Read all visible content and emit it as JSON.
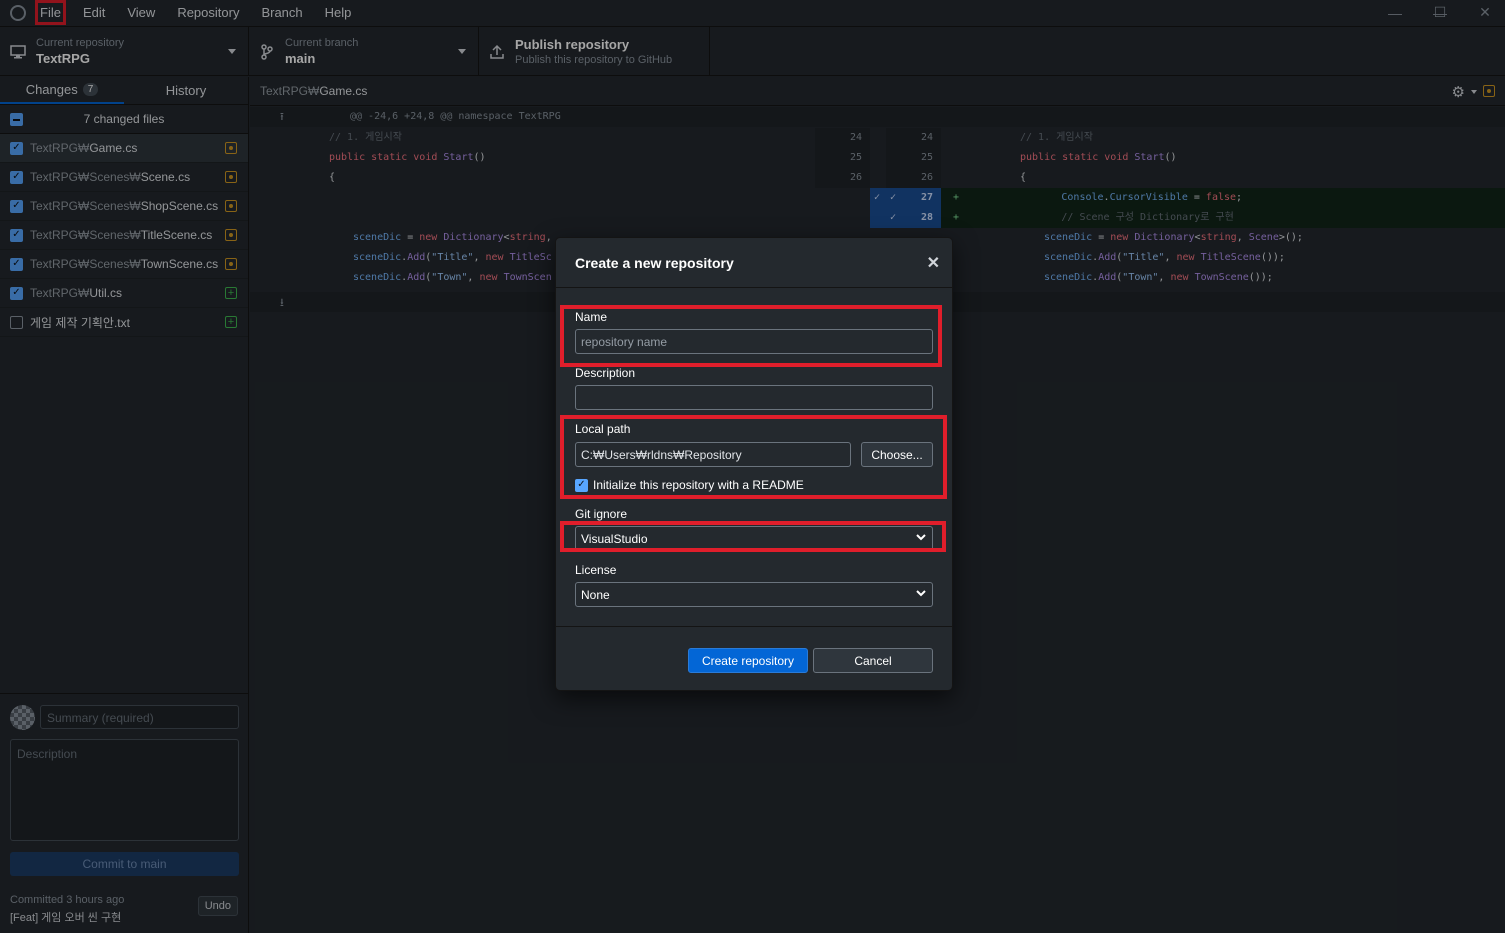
{
  "menu": {
    "items": [
      "File",
      "Edit",
      "View",
      "Repository",
      "Branch",
      "Help"
    ]
  },
  "window_controls": {
    "minimize": "—",
    "maximize": "☐",
    "close": "✕"
  },
  "toolbar": {
    "repo_label": "Current repository",
    "repo_value": "TextRPG",
    "branch_label": "Current branch",
    "branch_value": "main",
    "publish_title": "Publish repository",
    "publish_sub": "Publish this repository to GitHub"
  },
  "sidebar": {
    "tab_changes": "Changes",
    "tab_changes_count": "7",
    "tab_history": "History",
    "changed_files_label": "7 changed files",
    "files": [
      {
        "dir": "TextRPG₩",
        "name": "Game.cs",
        "checked": true,
        "status": "modified",
        "selected": true
      },
      {
        "dir": "TextRPG₩Scenes₩",
        "name": "Scene.cs",
        "checked": true,
        "status": "modified"
      },
      {
        "dir": "TextRPG₩Scenes₩",
        "name": "ShopScene.cs",
        "checked": true,
        "status": "modified"
      },
      {
        "dir": "TextRPG₩Scenes₩",
        "name": "TitleScene.cs",
        "checked": true,
        "status": "modified"
      },
      {
        "dir": "TextRPG₩Scenes₩",
        "name": "TownScene.cs",
        "checked": true,
        "status": "modified"
      },
      {
        "dir": "TextRPG₩",
        "name": "Util.cs",
        "checked": true,
        "status": "added"
      },
      {
        "dir": "",
        "name": "게임 제작 기획안.txt",
        "checked": false,
        "status": "added"
      }
    ],
    "summary_placeholder": "Summary (required)",
    "description_placeholder": "Description",
    "commit_button": "Commit to main",
    "committed_time": "Committed 3 hours ago",
    "committed_msg": "[Feat] 게임 오버 씬 구현",
    "undo_button": "Undo"
  },
  "diff": {
    "file_dir": "TextRPG₩",
    "file_name": "Game.cs",
    "hunk_header": "@@ -24,6 +24,8 @@ namespace TextRPG",
    "old_numbers": [
      "24",
      "25",
      "26"
    ],
    "new_numbers": [
      "24",
      "25",
      "26",
      "27",
      "28"
    ],
    "plus_sign": "+"
  },
  "modal": {
    "title": "Create a new repository",
    "close_icon": "✕",
    "name_label": "Name",
    "name_placeholder": "repository name",
    "description_label": "Description",
    "local_path_label": "Local path",
    "local_path_value": "C:₩Users₩rldns₩Repository",
    "choose_button": "Choose...",
    "readme_label": "Initialize this repository with a README",
    "readme_checked": true,
    "gitignore_label": "Git ignore",
    "gitignore_value": "VisualStudio",
    "license_label": "License",
    "license_value": "None",
    "create_button": "Create repository",
    "cancel_button": "Cancel"
  },
  "colors": {
    "highlight_box": "#e01e2b",
    "accent": "#0366d6",
    "background": "#24292e"
  }
}
